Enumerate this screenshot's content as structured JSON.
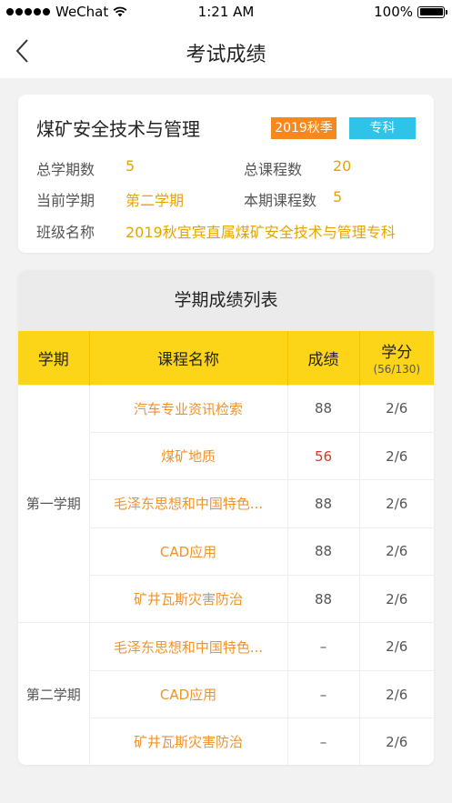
{
  "status_bar": {
    "carrier": "WeChat",
    "time": "1:21 AM",
    "battery": "100%"
  },
  "nav": {
    "title": "考试成绩",
    "back_icon": "chevron-left-icon"
  },
  "program": {
    "name": "煤矿安全技术与管理",
    "season_tag": "2019秋季",
    "level_tag": "专科",
    "total_terms_label": "总学期数",
    "total_terms": "5",
    "total_courses_label": "总课程数",
    "total_courses": "20",
    "current_term_label": "当前学期",
    "current_term": "第二学期",
    "term_courses_label": "本期课程数",
    "term_courses": "5",
    "class_label": "班级名称",
    "class_name": "2019秋宜宾直属煤矿安全技术与管理专科"
  },
  "grades": {
    "title": "学期成绩列表",
    "headers": {
      "term": "学期",
      "course": "课程名称",
      "score": "成绩",
      "credit": "学分",
      "credit_sub": "(56/130)"
    },
    "terms": [
      {
        "name": "第一学期",
        "rows": [
          {
            "course": "汽车专业资讯检索",
            "score": "88",
            "credit": "2/6"
          },
          {
            "course": "煤矿地质",
            "score": "56",
            "credit": "2/6"
          },
          {
            "course": "毛泽东思想和中国特色...",
            "score": "88",
            "credit": "2/6"
          },
          {
            "course": "CAD应用",
            "score": "88",
            "credit": "2/6"
          },
          {
            "course": "矿井瓦斯灾害防治",
            "score": "88",
            "credit": "2/6"
          }
        ]
      },
      {
        "name": "第二学期",
        "rows": [
          {
            "course": "毛泽东思想和中国特色...",
            "score": "–",
            "credit": "2/6"
          },
          {
            "course": "CAD应用",
            "score": "–",
            "credit": "2/6"
          },
          {
            "course": "矿井瓦斯灾害防治",
            "score": "–",
            "credit": "2/6"
          }
        ]
      }
    ]
  },
  "colors": {
    "accent_yellow": "#fcd418",
    "value_gold": "#e6a400",
    "course_orange": "#f0932a",
    "season_tag": "#f6881e",
    "level_tag": "#2fc3e8",
    "fail_red": "#d9362b"
  }
}
